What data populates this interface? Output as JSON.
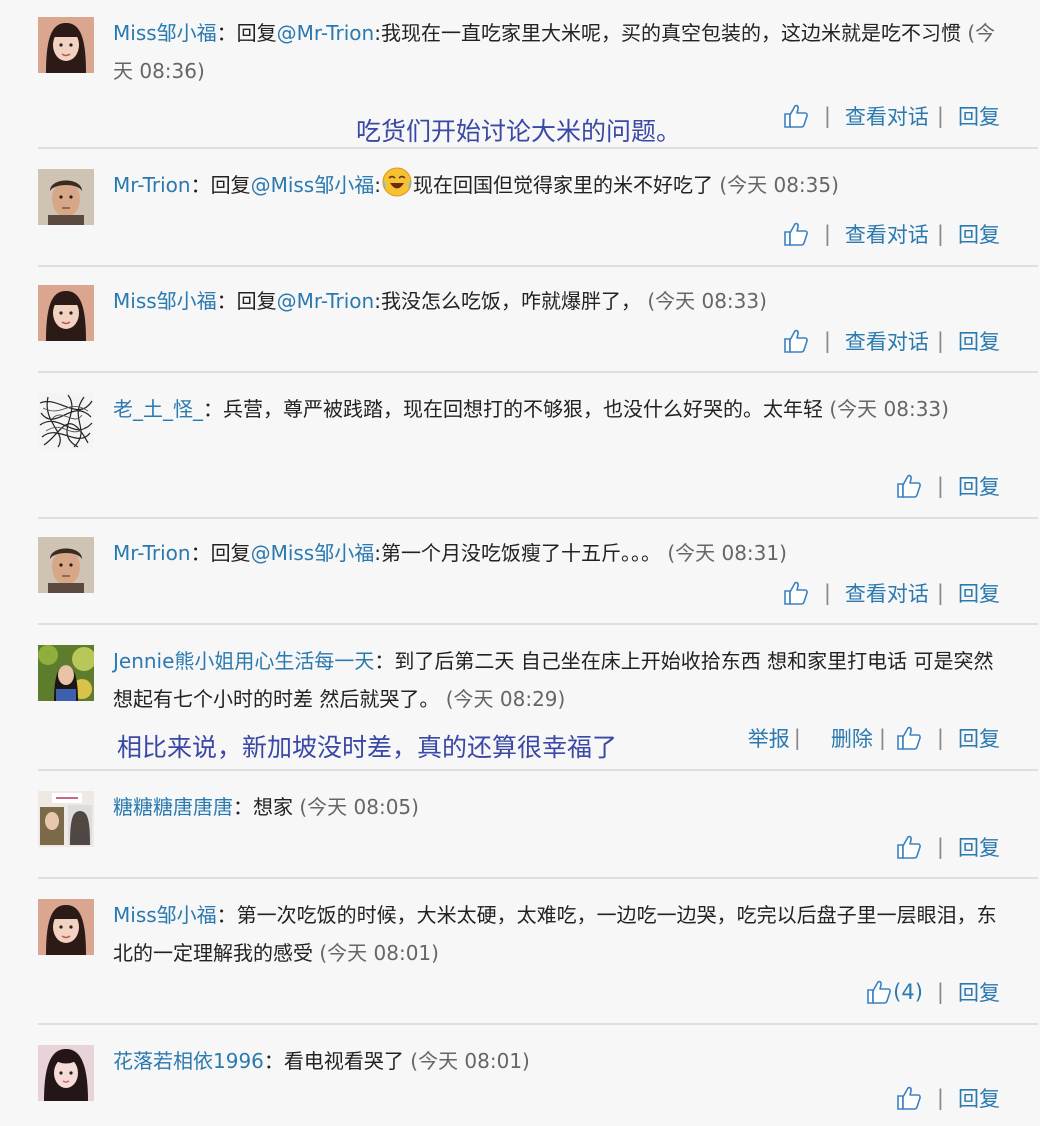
{
  "accent_color": "#2a7ab0",
  "annotation_color": "#3a48a6",
  "labels": {
    "reply": "回复",
    "view_conversation": "查看对话",
    "report": "举报",
    "delete": "删除",
    "separator": "|",
    "colon": "："
  },
  "annotations": [
    "吃货们开始讨论大米的问题。",
    "相比来说，新加坡没时差，真的还算很幸福了"
  ],
  "comments": [
    {
      "username": "Miss邹小福",
      "reply_prefix": "回复",
      "mention": "@Mr-Trion",
      "mention_sep": ":",
      "text": "我现在一直吃家里大米呢，买的真空包装的，这边米就是吃不习惯",
      "time": "(今天 08:36)",
      "like_count": "",
      "avatar": "girl-selfie-avatar"
    },
    {
      "username": "Mr-Trion",
      "reply_prefix": "回复",
      "mention": "@Miss邹小福",
      "mention_sep": ":",
      "emoji": "crying-laughing-emoji",
      "text": "现在回国但觉得家里的米不好吃了",
      "time": "(今天 08:35)",
      "like_count": "",
      "avatar": "man-portrait-avatar"
    },
    {
      "username": "Miss邹小福",
      "reply_prefix": "回复",
      "mention": "@Mr-Trion",
      "mention_sep": ":",
      "text": "我没怎么吃饭，咋就爆胖了，",
      "time": "(今天 08:33)",
      "like_count": "",
      "avatar": "girl-selfie-avatar"
    },
    {
      "username": "老_土_怪_",
      "reply_prefix": "",
      "mention": "",
      "mention_sep": "",
      "text": "兵营，尊严被践踏，现在回想打的不够狠，也没什么好哭的。太年轻",
      "time": "(今天 08:33)",
      "like_count": "",
      "avatar": "scribble-avatar"
    },
    {
      "username": "Mr-Trion",
      "reply_prefix": "回复",
      "mention": "@Miss邹小福",
      "mention_sep": ":",
      "text": "第一个月没吃饭瘦了十五斤。。。",
      "time": "(今天 08:31)",
      "like_count": "",
      "avatar": "man-portrait-avatar"
    },
    {
      "username": "Jennie熊小姐用心生活每一天",
      "reply_prefix": "",
      "mention": "",
      "mention_sep": "",
      "text": "到了后第二天 自己坐在床上开始收拾东西 想和家里打电话 可是突然想起有七个小时的时差 然后就哭了。",
      "time": "(今天 08:29)",
      "like_count": "",
      "avatar": "girl-outdoor-avatar"
    },
    {
      "username": "糖糖糖唐唐唐",
      "reply_prefix": "",
      "mention": "",
      "mention_sep": "",
      "text": "想家",
      "time": "(今天 08:05)",
      "like_count": "",
      "avatar": "collage-avatar"
    },
    {
      "username": "Miss邹小福",
      "reply_prefix": "",
      "mention": "",
      "mention_sep": "",
      "text": "第一次吃饭的时候，大米太硬，太难吃，一边吃一边哭，吃完以后盘子里一层眼泪，东北的一定理解我的感受",
      "time": "(今天 08:01)",
      "like_count": "(4)",
      "avatar": "girl-selfie-avatar"
    },
    {
      "username": "花落若相依1996",
      "reply_prefix": "",
      "mention": "",
      "mention_sep": "",
      "text": "看电视看哭了",
      "time": "(今天 08:01)",
      "like_count": "",
      "avatar": "girl-longhair-avatar"
    }
  ]
}
